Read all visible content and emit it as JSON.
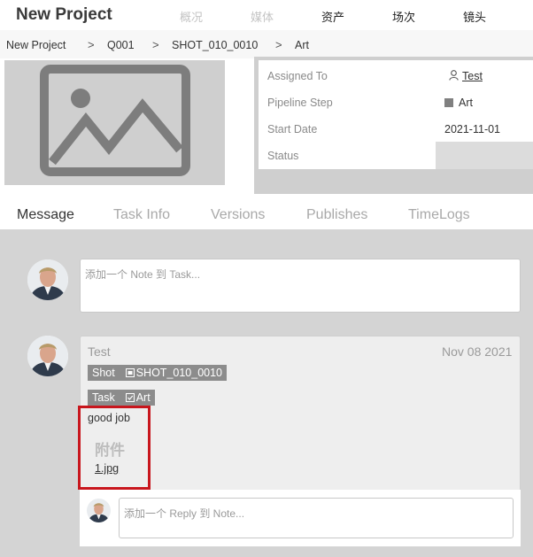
{
  "app": {
    "title": "New Project"
  },
  "nav": {
    "items": [
      {
        "label": "概况",
        "state": "disabled"
      },
      {
        "label": "媒体",
        "state": "disabled"
      },
      {
        "label": "资产",
        "state": "active"
      },
      {
        "label": "场次",
        "state": "active"
      },
      {
        "label": "镜头",
        "state": "active"
      }
    ]
  },
  "breadcrumb": {
    "items": [
      "New Project",
      "Q001",
      "SHOT_010_0010",
      "Art"
    ],
    "separator": ">"
  },
  "info": {
    "assigned_to_label": "Assigned To",
    "assigned_to_value": "Test",
    "pipeline_step_label": "Pipeline Step",
    "pipeline_step_value": "Art",
    "start_date_label": "Start Date",
    "start_date_value": "2021-11-01",
    "status_label": "Status",
    "status_value": ""
  },
  "tabs": [
    {
      "label": "Message",
      "active": true
    },
    {
      "label": "Task Info",
      "active": false
    },
    {
      "label": "Versions",
      "active": false
    },
    {
      "label": "Publishes",
      "active": false
    },
    {
      "label": "TimeLogs",
      "active": false
    }
  ],
  "note_input": {
    "placeholder": "添加一个 Note 到 Task..."
  },
  "note": {
    "author": "Test",
    "date": "Nov 08 2021",
    "shot_tag_label": "Shot",
    "shot_tag_value": "SHOT_010_0010",
    "task_tag_label": "Task",
    "task_tag_value": "Art",
    "body": "good job",
    "attachments_label": "附件",
    "attachment_file": "1.jpg"
  },
  "reply_input": {
    "placeholder": "添加一个 Reply 到 Note..."
  },
  "colors": {
    "highlight": "#c8161d",
    "tag_bg": "#8c8c8c",
    "panel_bg": "#d4d4d4"
  },
  "icons": [
    "image-placeholder-icon",
    "user-icon",
    "shot-icon",
    "task-icon"
  ]
}
